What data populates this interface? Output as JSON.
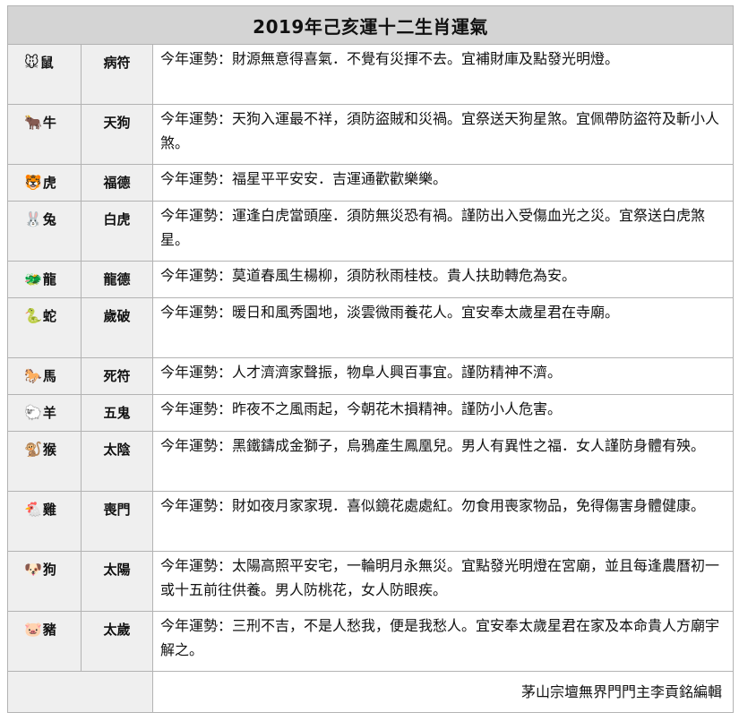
{
  "title": "2019年己亥運十二生肖運氣",
  "rows": [
    {
      "emoji": "🐭",
      "animal": "鼠",
      "star": "病符",
      "text": "今年運勢：財源無意得喜氣．不覺有災揮不去。宜補財庫及點發光明燈。"
    },
    {
      "emoji": "🐂",
      "animal": "牛",
      "star": "天狗",
      "text": "今年運勢：天狗入運最不祥，須防盜賊和災禍。宜祭送天狗星煞。宜佩帶防盜符及斬小人煞。"
    },
    {
      "emoji": "🐯",
      "animal": "虎",
      "star": "福德",
      "text": "今年運勢：福星平平安安．吉運通歡歡樂樂。"
    },
    {
      "emoji": "🐰",
      "animal": "兔",
      "star": "白虎",
      "text": "今年運勢：運逢白虎當頭座．須防無災恐有禍。謹防出入受傷血光之災。宜祭送白虎煞星。"
    },
    {
      "emoji": "🐲",
      "animal": "龍",
      "star": "龍德",
      "text": "今年運勢：莫道春風生楊柳，須防秋雨桂枝。貴人扶助轉危為安。"
    },
    {
      "emoji": "🐍",
      "animal": "蛇",
      "star": "歲破",
      "text": "今年運勢：暖日和風秀園地，淡雲微雨養花人。宜安奉太歲星君在寺廟。"
    },
    {
      "emoji": "🐎",
      "animal": "馬",
      "star": "死符",
      "text": "今年運勢：人才濟濟家聲振，物阜人興百事宜。謹防精神不濟。"
    },
    {
      "emoji": "🐑",
      "animal": "羊",
      "star": "五鬼",
      "text": "今年運勢：昨夜不之風雨起，今朝花木損精神。謹防小人危害。"
    },
    {
      "emoji": "🐒",
      "animal": "猴",
      "star": "太陰",
      "text": "今年運勢：黑鐵鑄成金獅子，烏鴉產生鳳凰兒。男人有異性之福．女人謹防身體有殃。"
    },
    {
      "emoji": "🐔",
      "animal": "雞",
      "star": "喪門",
      "text": "今年運勢：財如夜月家家現．喜似鏡花處處紅。勿食用喪家物品，免得傷害身體健康。"
    },
    {
      "emoji": "🐶",
      "animal": "狗",
      "star": "太陽",
      "text": "今年運勢：太陽高照平安宅，一輪明月永無災。宜點發光明燈在宮廟，並且每逢農曆初一或十五前往供養。男人防桃花，女人防眼疾。"
    },
    {
      "emoji": "🐷",
      "animal": "豬",
      "star": "太歲",
      "text": "今年運勢：三刑不吉，不是人愁我，便是我愁人。宜安奉太歲星君在家及本命貴人方廟宇解之。"
    }
  ],
  "footer": "茅山宗壇無界門門主李貢銘編輯"
}
